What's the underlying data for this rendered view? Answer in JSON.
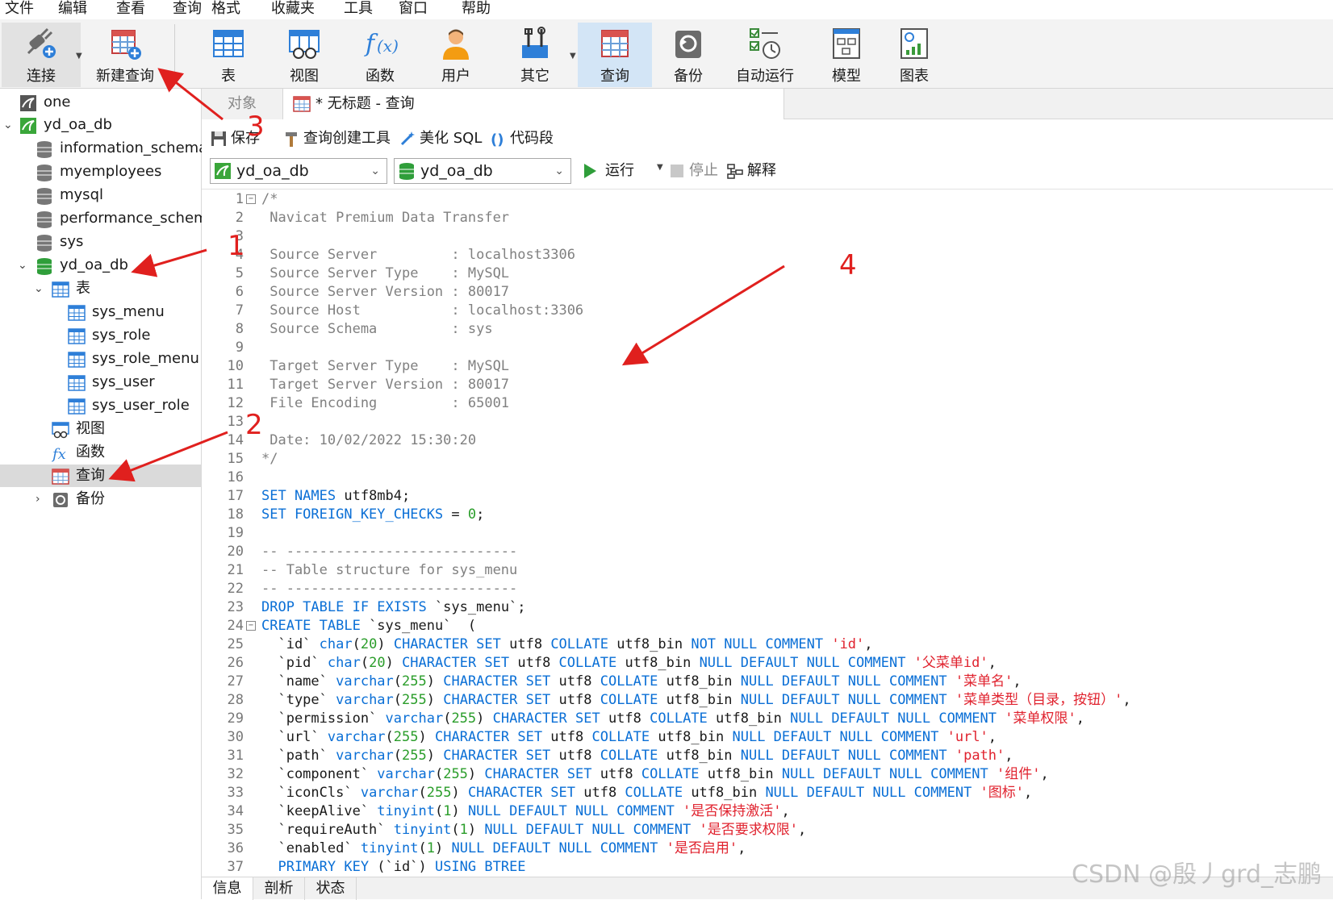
{
  "menu": [
    "文件",
    "编辑",
    "查看",
    "查询",
    "格式",
    "收藏夹",
    "工具",
    "窗口",
    "帮助"
  ],
  "toolbar": {
    "connect": "连接",
    "new_query": "新建查询",
    "table": "表",
    "view": "视图",
    "function": "函数",
    "user": "用户",
    "other": "其它",
    "query": "查询",
    "backup": "备份",
    "auto_run": "自动运行",
    "model": "模型",
    "chart": "图表"
  },
  "tree": {
    "items": [
      {
        "label": "one"
      },
      {
        "label": "yd_oa_db"
      },
      {
        "label": "information_schema"
      },
      {
        "label": "myemployees"
      },
      {
        "label": "mysql"
      },
      {
        "label": "performance_schema"
      },
      {
        "label": "sys"
      },
      {
        "label": "yd_oa_db"
      },
      {
        "label": "表"
      },
      {
        "label": "sys_menu"
      },
      {
        "label": "sys_role"
      },
      {
        "label": "sys_role_menu"
      },
      {
        "label": "sys_user"
      },
      {
        "label": "sys_user_role"
      },
      {
        "label": "视图"
      },
      {
        "label": "函数"
      },
      {
        "label": "查询"
      },
      {
        "label": "备份"
      }
    ]
  },
  "tabs": {
    "objects": "对象",
    "query_tab": "* 无标题 - 查询"
  },
  "editor_toolbar": {
    "save": "保存",
    "query_builder": "查询创建工具",
    "beautify": "美化 SQL",
    "snippet": "代码段"
  },
  "db_row": {
    "connection": "yd_oa_db",
    "database": "yd_oa_db",
    "run": "运行",
    "stop": "停止",
    "explain": "解释"
  },
  "bottom_tabs": [
    "信息",
    "剖析",
    "状态"
  ],
  "watermark": "CSDN @殷丿grd_志鹏",
  "annotations": [
    "1",
    "2",
    "3",
    "4"
  ],
  "code_lines": [
    [
      [
        "c",
        "/*"
      ]
    ],
    [
      [
        "c",
        " Navicat Premium Data Transfer"
      ]
    ],
    [
      [
        "c",
        ""
      ]
    ],
    [
      [
        "c",
        " Source Server         : localhost3306"
      ]
    ],
    [
      [
        "c",
        " Source Server Type    : MySQL"
      ]
    ],
    [
      [
        "c",
        " Source Server Version : 80017"
      ]
    ],
    [
      [
        "c",
        " Source Host           : localhost:3306"
      ]
    ],
    [
      [
        "c",
        " Source Schema         : sys"
      ]
    ],
    [
      [
        "c",
        ""
      ]
    ],
    [
      [
        "c",
        " Target Server Type    : MySQL"
      ]
    ],
    [
      [
        "c",
        " Target Server Version : 80017"
      ]
    ],
    [
      [
        "c",
        " File Encoding         : 65001"
      ]
    ],
    [
      [
        "c",
        ""
      ]
    ],
    [
      [
        "c",
        " Date: 10/02/2022 15:30:20"
      ]
    ],
    [
      [
        "c",
        "*/"
      ]
    ],
    [],
    [
      [
        "k",
        "SET NAMES "
      ],
      [
        "i",
        "utf8mb4;"
      ]
    ],
    [
      [
        "k",
        "SET FOREIGN_KEY_CHECKS "
      ],
      [
        "i",
        "= "
      ],
      [
        "n",
        "0"
      ],
      [
        "i",
        ";"
      ]
    ],
    [],
    [
      [
        "c",
        "-- ----------------------------"
      ]
    ],
    [
      [
        "c",
        "-- Table structure for sys_menu"
      ]
    ],
    [
      [
        "c",
        "-- ----------------------------"
      ]
    ],
    [
      [
        "k",
        "DROP TABLE IF EXISTS "
      ],
      [
        "i",
        "`sys_menu`;"
      ]
    ],
    [
      [
        "k",
        "CREATE TABLE "
      ],
      [
        "i",
        "`sys_menu`  ("
      ]
    ],
    [
      [
        "i",
        "  `id` "
      ],
      [
        "k",
        "char"
      ],
      [
        "i",
        "("
      ],
      [
        "n",
        "20"
      ],
      [
        "i",
        ") "
      ],
      [
        "k",
        "CHARACTER SET "
      ],
      [
        "i",
        "utf8 "
      ],
      [
        "k",
        "COLLATE "
      ],
      [
        "i",
        "utf8_bin "
      ],
      [
        "k",
        "NOT NULL COMMENT "
      ],
      [
        "s",
        "'id'"
      ],
      [
        "i",
        ","
      ]
    ],
    [
      [
        "i",
        "  `pid` "
      ],
      [
        "k",
        "char"
      ],
      [
        "i",
        "("
      ],
      [
        "n",
        "20"
      ],
      [
        "i",
        ") "
      ],
      [
        "k",
        "CHARACTER SET "
      ],
      [
        "i",
        "utf8 "
      ],
      [
        "k",
        "COLLATE "
      ],
      [
        "i",
        "utf8_bin "
      ],
      [
        "k",
        "NULL DEFAULT NULL COMMENT "
      ],
      [
        "s",
        "'父菜单id'"
      ],
      [
        "i",
        ","
      ]
    ],
    [
      [
        "i",
        "  `name` "
      ],
      [
        "k",
        "varchar"
      ],
      [
        "i",
        "("
      ],
      [
        "n",
        "255"
      ],
      [
        "i",
        ") "
      ],
      [
        "k",
        "CHARACTER SET "
      ],
      [
        "i",
        "utf8 "
      ],
      [
        "k",
        "COLLATE "
      ],
      [
        "i",
        "utf8_bin "
      ],
      [
        "k",
        "NULL DEFAULT NULL COMMENT "
      ],
      [
        "s",
        "'菜单名'"
      ],
      [
        "i",
        ","
      ]
    ],
    [
      [
        "i",
        "  `type` "
      ],
      [
        "k",
        "varchar"
      ],
      [
        "i",
        "("
      ],
      [
        "n",
        "255"
      ],
      [
        "i",
        ") "
      ],
      [
        "k",
        "CHARACTER SET "
      ],
      [
        "i",
        "utf8 "
      ],
      [
        "k",
        "COLLATE "
      ],
      [
        "i",
        "utf8_bin "
      ],
      [
        "k",
        "NULL DEFAULT NULL COMMENT "
      ],
      [
        "s",
        "'菜单类型（目录，按钮）'"
      ],
      [
        "i",
        ","
      ]
    ],
    [
      [
        "i",
        "  `permission` "
      ],
      [
        "k",
        "varchar"
      ],
      [
        "i",
        "("
      ],
      [
        "n",
        "255"
      ],
      [
        "i",
        ") "
      ],
      [
        "k",
        "CHARACTER SET "
      ],
      [
        "i",
        "utf8 "
      ],
      [
        "k",
        "COLLATE "
      ],
      [
        "i",
        "utf8_bin "
      ],
      [
        "k",
        "NULL DEFAULT NULL COMMENT "
      ],
      [
        "s",
        "'菜单权限'"
      ],
      [
        "i",
        ","
      ]
    ],
    [
      [
        "i",
        "  `url` "
      ],
      [
        "k",
        "varchar"
      ],
      [
        "i",
        "("
      ],
      [
        "n",
        "255"
      ],
      [
        "i",
        ") "
      ],
      [
        "k",
        "CHARACTER SET "
      ],
      [
        "i",
        "utf8 "
      ],
      [
        "k",
        "COLLATE "
      ],
      [
        "i",
        "utf8_bin "
      ],
      [
        "k",
        "NULL DEFAULT NULL COMMENT "
      ],
      [
        "s",
        "'url'"
      ],
      [
        "i",
        ","
      ]
    ],
    [
      [
        "i",
        "  `path` "
      ],
      [
        "k",
        "varchar"
      ],
      [
        "i",
        "("
      ],
      [
        "n",
        "255"
      ],
      [
        "i",
        ") "
      ],
      [
        "k",
        "CHARACTER SET "
      ],
      [
        "i",
        "utf8 "
      ],
      [
        "k",
        "COLLATE "
      ],
      [
        "i",
        "utf8_bin "
      ],
      [
        "k",
        "NULL DEFAULT NULL COMMENT "
      ],
      [
        "s",
        "'path'"
      ],
      [
        "i",
        ","
      ]
    ],
    [
      [
        "i",
        "  `component` "
      ],
      [
        "k",
        "varchar"
      ],
      [
        "i",
        "("
      ],
      [
        "n",
        "255"
      ],
      [
        "i",
        ") "
      ],
      [
        "k",
        "CHARACTER SET "
      ],
      [
        "i",
        "utf8 "
      ],
      [
        "k",
        "COLLATE "
      ],
      [
        "i",
        "utf8_bin "
      ],
      [
        "k",
        "NULL DEFAULT NULL COMMENT "
      ],
      [
        "s",
        "'组件'"
      ],
      [
        "i",
        ","
      ]
    ],
    [
      [
        "i",
        "  `iconCls` "
      ],
      [
        "k",
        "varchar"
      ],
      [
        "i",
        "("
      ],
      [
        "n",
        "255"
      ],
      [
        "i",
        ") "
      ],
      [
        "k",
        "CHARACTER SET "
      ],
      [
        "i",
        "utf8 "
      ],
      [
        "k",
        "COLLATE "
      ],
      [
        "i",
        "utf8_bin "
      ],
      [
        "k",
        "NULL DEFAULT NULL COMMENT "
      ],
      [
        "s",
        "'图标'"
      ],
      [
        "i",
        ","
      ]
    ],
    [
      [
        "i",
        "  `keepAlive` "
      ],
      [
        "k",
        "tinyint"
      ],
      [
        "i",
        "("
      ],
      [
        "n",
        "1"
      ],
      [
        "i",
        ") "
      ],
      [
        "k",
        "NULL DEFAULT NULL COMMENT "
      ],
      [
        "s",
        "'是否保持激活'"
      ],
      [
        "i",
        ","
      ]
    ],
    [
      [
        "i",
        "  `requireAuth` "
      ],
      [
        "k",
        "tinyint"
      ],
      [
        "i",
        "("
      ],
      [
        "n",
        "1"
      ],
      [
        "i",
        ") "
      ],
      [
        "k",
        "NULL DEFAULT NULL COMMENT "
      ],
      [
        "s",
        "'是否要求权限'"
      ],
      [
        "i",
        ","
      ]
    ],
    [
      [
        "i",
        "  `enabled` "
      ],
      [
        "k",
        "tinyint"
      ],
      [
        "i",
        "("
      ],
      [
        "n",
        "1"
      ],
      [
        "i",
        ") "
      ],
      [
        "k",
        "NULL DEFAULT NULL COMMENT "
      ],
      [
        "s",
        "'是否启用'"
      ],
      [
        "i",
        ","
      ]
    ],
    [
      [
        "k",
        "  PRIMARY KEY "
      ],
      [
        "i",
        "(`id`) "
      ],
      [
        "k",
        "USING BTREE"
      ]
    ]
  ],
  "colors": {
    "keyword": "#0a6fd6",
    "string": "#e0222e",
    "number": "#2a9d2a",
    "comment": "#808080",
    "annotation": "#e0201e",
    "active_toolbar": "#d3e5f6"
  }
}
